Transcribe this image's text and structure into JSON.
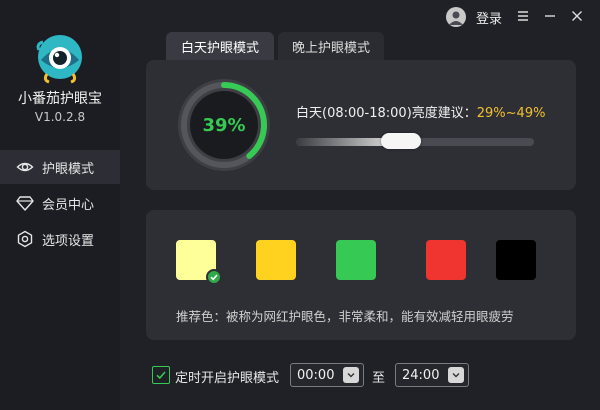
{
  "app": {
    "name": "小番茄护眼宝",
    "version": "V1.0.2.8"
  },
  "header": {
    "login_label": "登录"
  },
  "sidebar": {
    "items": [
      {
        "label": "护眼模式",
        "icon": "eye-icon",
        "active": true
      },
      {
        "label": "会员中心",
        "icon": "diamond-icon",
        "active": false
      },
      {
        "label": "选项设置",
        "icon": "settings-hexagon-icon",
        "active": false
      }
    ]
  },
  "tabs": [
    {
      "label": "白天护眼模式",
      "active": true
    },
    {
      "label": "晚上护眼模式",
      "active": false
    }
  ],
  "brightness": {
    "percent_label": "39%",
    "percent": 39,
    "suggestion_label": "白天(08:00-18:00)亮度建议：",
    "suggestion_range": "29%~49%",
    "slider_value": 39
  },
  "colors": {
    "swatches": [
      {
        "name": "light-yellow",
        "hex": "#ffff99",
        "selected": true
      },
      {
        "name": "yellow",
        "hex": "#ffd21f",
        "selected": false
      },
      {
        "name": "green",
        "hex": "#36c954",
        "selected": false
      },
      {
        "name": "red",
        "hex": "#f03530",
        "selected": false
      },
      {
        "name": "black",
        "hex": "#000000",
        "selected": false
      }
    ],
    "recommend_text": "推荐色：被称为网红护眼色，非常柔和，能有效减轻用眼疲劳"
  },
  "timer": {
    "checked": true,
    "label": "定时开启护眼模式",
    "start": "00:00",
    "to_label": "至",
    "end": "24:00"
  },
  "accent": "#36c954"
}
